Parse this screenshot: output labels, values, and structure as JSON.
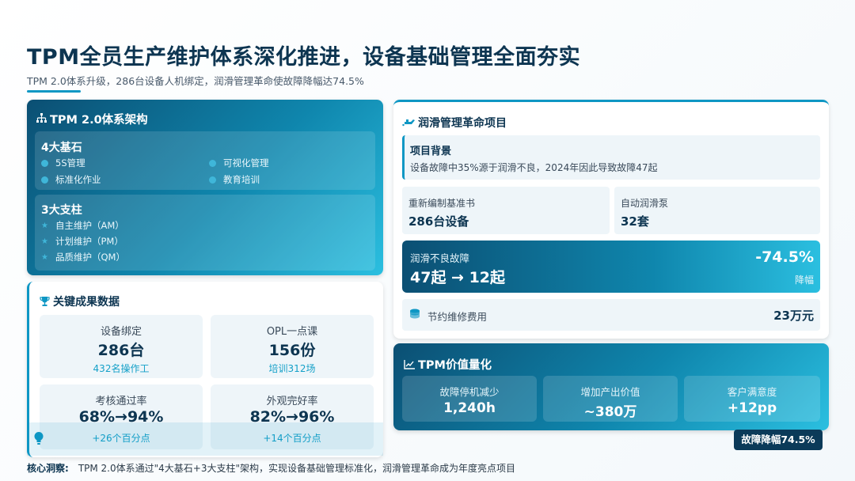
{
  "header": {
    "title": "TPM全员生产维护体系深化推进，设备基础管理全面夯实",
    "subtitle": "TPM 2.0体系升级，286台设备人机绑定，润滑管理革命使故障降幅达74.5%"
  },
  "architecture": {
    "title": "TPM 2.0体系架构",
    "foundations": {
      "title": "4大基石",
      "items": [
        "5S管理",
        "可视化管理",
        "标准化作业",
        "教育培训"
      ]
    },
    "pillars": {
      "title": "3大支柱",
      "items": [
        "自主维护（AM）",
        "计划维护（PM）",
        "品质维护（QM）"
      ]
    }
  },
  "kpis": {
    "title": "关键成果数据",
    "cards": [
      {
        "label": "设备绑定",
        "value": "286台",
        "sub": "432名操作工"
      },
      {
        "label": "OPL一点课",
        "value": "156份",
        "sub": "培训312场"
      },
      {
        "label": "考核通过率",
        "value": "68%→94%",
        "sub": "+26个百分点"
      },
      {
        "label": "外观完好率",
        "value": "82%→96%",
        "sub": "+14个百分点"
      }
    ]
  },
  "lubrication": {
    "title": "润滑管理革命项目",
    "background": {
      "title": "项目背景",
      "text": "设备故障中35%源于润滑不良，2024年因此导致故障47起"
    },
    "stats": [
      {
        "label": "重新编制基准书",
        "value": "286台设备"
      },
      {
        "label": "自动润滑泵",
        "value": "32套"
      }
    ],
    "failure": {
      "label": "润滑不良故障",
      "value": "47起 → 12起",
      "percent": "-74.5%",
      "percent_label": "降幅"
    },
    "saving": {
      "label": "节约维修费用",
      "value": "23万元"
    }
  },
  "value": {
    "title": "TPM价值量化",
    "cards": [
      {
        "label": "故障停机减少",
        "value": "1,240h"
      },
      {
        "label": "增加产出价值",
        "value": "~380万"
      },
      {
        "label": "客户满意度",
        "value": "+12pp"
      }
    ],
    "badge": "故障降幅74.5%"
  },
  "insight": {
    "label": "核心洞察:",
    "text": "TPM 2.0体系通过\"4大基石+3大支柱\"架构，实现设备基础管理标准化，润滑管理革命成为年度亮点项目"
  },
  "colors": {
    "accent": "#0e97c4",
    "navy": "#0d3551",
    "panel_gradient_start": "#0b4f73",
    "panel_gradient_end": "#2bbfe0"
  },
  "icons": {
    "architecture": "org-chart-icon",
    "kpis": "trophy-icon",
    "lubrication": "oil-can-icon",
    "saving": "coin-stack-icon",
    "value": "line-chart-icon",
    "insight": "lightbulb-icon"
  }
}
